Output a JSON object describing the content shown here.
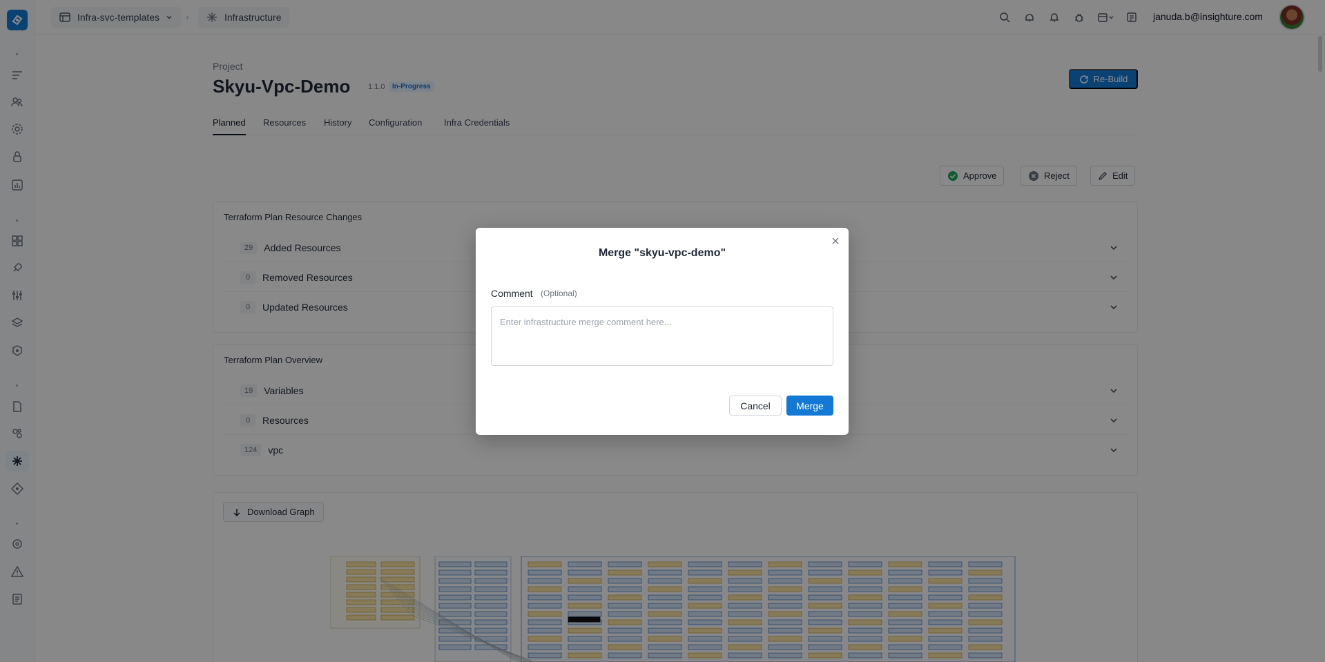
{
  "topbar": {
    "breadcrumb": [
      {
        "label": "Infra-svc-templates",
        "icon": "table-icon"
      },
      {
        "label": "Infrastructure",
        "icon": "infrastructure-icon"
      }
    ],
    "breadcrumb_separator": "›",
    "user_email": "januda.b@insighture.com"
  },
  "project": {
    "label": "Project",
    "name": "Skyu-Vpc-Demo",
    "version": "1.1.0",
    "status": "In-Progress",
    "rebuild_label": "Re-Build"
  },
  "tabs": [
    {
      "label": "Planned",
      "active": true
    },
    {
      "label": "Resources",
      "active": false
    },
    {
      "label": "History",
      "active": false
    },
    {
      "label": "Configuration",
      "active": false
    },
    {
      "label": "Infra Credentials",
      "active": false
    }
  ],
  "actions": {
    "approve": "Approve",
    "reject": "Reject",
    "edit": "Edit"
  },
  "resource_changes": {
    "title": "Terraform Plan Resource Changes",
    "rows": [
      {
        "count": "29",
        "label": "Added Resources"
      },
      {
        "count": "0",
        "label": "Removed Resources"
      },
      {
        "count": "0",
        "label": "Updated Resources"
      }
    ]
  },
  "plan_overview": {
    "title": "Terraform Plan Overview",
    "rows": [
      {
        "count": "19",
        "label": "Variables"
      },
      {
        "count": "0",
        "label": "Resources"
      },
      {
        "count": "124",
        "label": "vpc"
      }
    ]
  },
  "graph": {
    "download_label": "Download Graph"
  },
  "modal": {
    "title": "Merge \"skyu-vpc-demo\"",
    "comment_label": "Comment",
    "comment_optional": "(Optional)",
    "comment_placeholder": "Enter infrastructure merge comment here...",
    "comment_value": "",
    "cancel_label": "Cancel",
    "merge_label": "Merge"
  },
  "colors": {
    "accent": "#1479d4",
    "approve": "#22a55a",
    "status_badge_bg": "#e3eefb"
  }
}
